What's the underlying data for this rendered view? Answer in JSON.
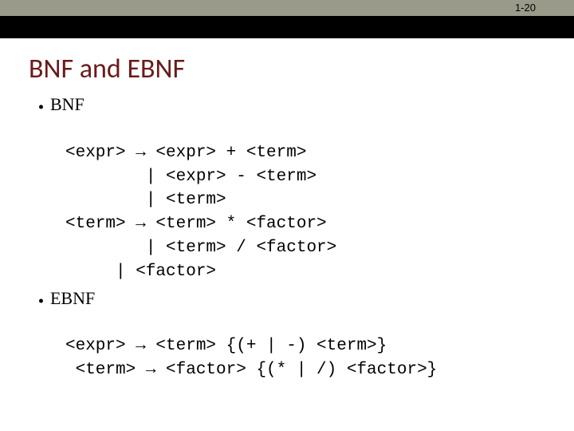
{
  "page_number": "1-20",
  "title": "BNF and EBNF",
  "sections": [
    {
      "label": "BNF",
      "lines": [
        "<expr> → <expr> + <term>",
        "        | <expr> - <term>",
        "        | <term>",
        "<term> → <term> * <factor>",
        "        | <term> / <factor>",
        "     | <factor>"
      ]
    },
    {
      "label": "EBNF",
      "lines": [
        "<expr> → <term> {(+ | -) <term>}",
        " <term> → <factor> {(* | /) <factor>}"
      ]
    }
  ]
}
